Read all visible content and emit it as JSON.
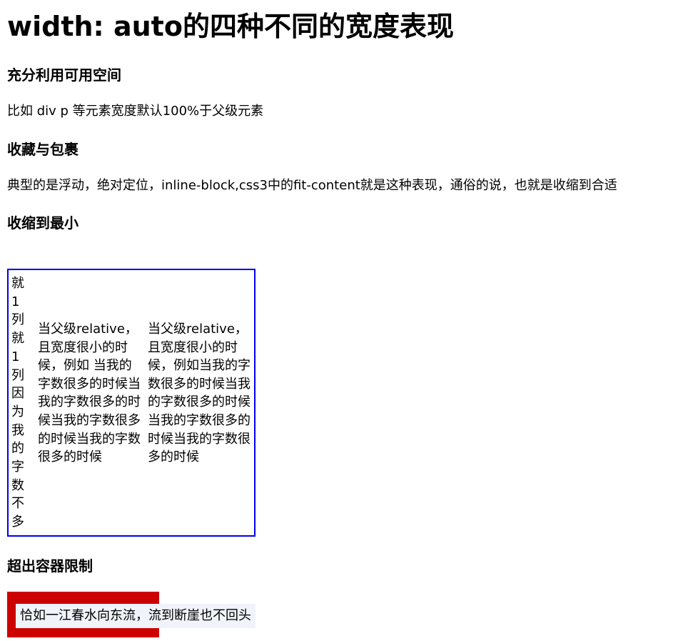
{
  "title": "width: auto的四种不同的宽度表现",
  "sections": {
    "fill": {
      "heading": "充分利用可用空间",
      "desc": "比如 div p 等元素宽度默认100%于父级元素"
    },
    "shrink_wrap": {
      "heading": "收藏与包裹",
      "desc": "典型的是浮动，绝对定位，inline-block,css3中的fit-content就是这种表现，通俗的说，也就是收缩到合适"
    },
    "shrink_min": {
      "heading": "收缩到最小",
      "col1": "就1列就1列因为我的字数不多",
      "col2": "当父级relative，且宽度很小的时候，例如 当我的字数很多的时候当我的字数很多的时候当我的字数很多的时候当我的字数很多的时候",
      "col3": "当父级relative，且宽度很小的时候，例如当我的字数很多的时候当我的字数很多的时候当我的字数很多的时候当我的字数很多的时候"
    },
    "overflow": {
      "heading": "超出容器限制",
      "text": "恰如一江春水向东流，流到断崖也不回头"
    }
  },
  "colors": {
    "demo_border": "#0000ee",
    "overflow_container": "#cc0000",
    "overflow_text_bg": "#f0f3f9"
  }
}
